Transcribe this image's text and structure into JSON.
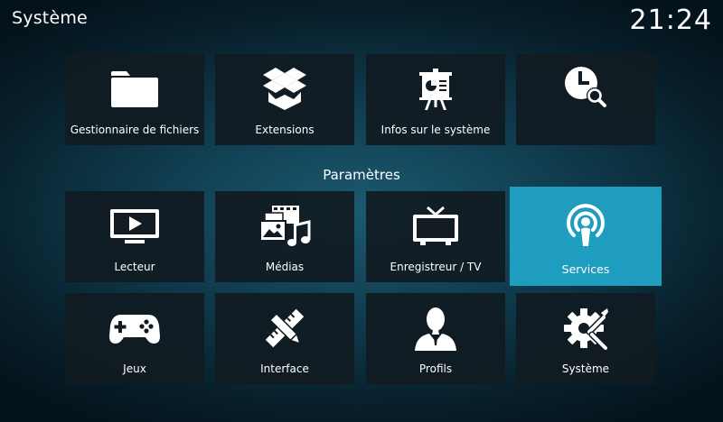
{
  "header": {
    "title": "Système",
    "clock": "21:24"
  },
  "top_row": [
    {
      "label": "Gestionnaire de fichiers",
      "icon": "folder-icon"
    },
    {
      "label": "Extensions",
      "icon": "package-icon"
    },
    {
      "label": "Infos sur le système",
      "icon": "presentation-board-icon"
    },
    {
      "label": "",
      "icon": "clock-search-icon"
    }
  ],
  "section": {
    "title": "Paramètres"
  },
  "settings": [
    {
      "label": "Lecteur",
      "icon": "play-monitor-icon"
    },
    {
      "label": "Médias",
      "icon": "media-library-icon"
    },
    {
      "label": "Enregistreur / TV",
      "icon": "tv-icon"
    },
    {
      "label": "Services",
      "icon": "podcast-icon",
      "focused": true
    },
    {
      "label": "Jeux",
      "icon": "gamepad-icon"
    },
    {
      "label": "Interface",
      "icon": "pencil-ruler-icon"
    },
    {
      "label": "Profils",
      "icon": "user-profile-icon"
    },
    {
      "label": "Système",
      "icon": "gear-tools-icon"
    }
  ],
  "colors": {
    "focus": "#1f9dbf",
    "tile": "#111b21",
    "text": "#ffffff"
  }
}
